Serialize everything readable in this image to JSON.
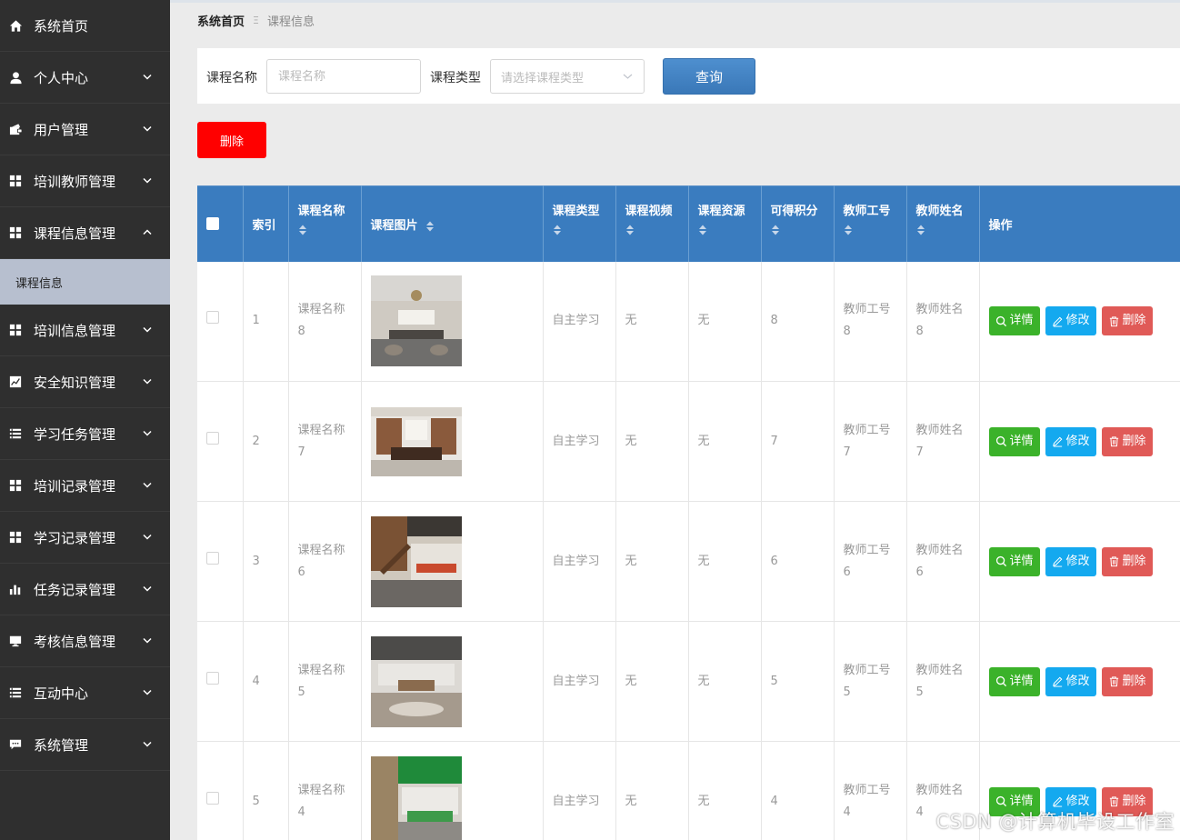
{
  "sidebar": {
    "items": [
      {
        "label": "系统首页",
        "icon": "home-icon",
        "expandable": false
      },
      {
        "label": "个人中心",
        "icon": "user-icon",
        "expandable": true
      },
      {
        "label": "用户管理",
        "icon": "user-manage-icon",
        "expandable": true
      },
      {
        "label": "培训教师管理",
        "icon": "grid-icon",
        "expandable": true
      },
      {
        "label": "课程信息管理",
        "icon": "grid-icon",
        "expandable": true,
        "expanded": true,
        "children": [
          "课程信息"
        ]
      },
      {
        "label": "培训信息管理",
        "icon": "grid-icon",
        "expandable": true
      },
      {
        "label": "安全知识管理",
        "icon": "chart-line-icon",
        "expandable": true
      },
      {
        "label": "学习任务管理",
        "icon": "list-icon",
        "expandable": true
      },
      {
        "label": "培训记录管理",
        "icon": "grid-icon",
        "expandable": true
      },
      {
        "label": "学习记录管理",
        "icon": "grid-icon",
        "expandable": true
      },
      {
        "label": "任务记录管理",
        "icon": "bar-chart-icon",
        "expandable": true
      },
      {
        "label": "考核信息管理",
        "icon": "monitor-icon",
        "expandable": true
      },
      {
        "label": "互动中心",
        "icon": "list-icon",
        "expandable": true
      },
      {
        "label": "系统管理",
        "icon": "chat-icon",
        "expandable": true
      }
    ]
  },
  "breadcrumb": {
    "home": "系统首页",
    "separator": "Ξ",
    "current": "课程信息"
  },
  "search": {
    "name_label": "课程名称",
    "name_placeholder": "课程名称",
    "type_label": "课程类型",
    "type_placeholder": "请选择课程类型",
    "query_label": "查询"
  },
  "toolbar": {
    "delete_label": "删除"
  },
  "table": {
    "headers": [
      "索引",
      "课程名称",
      "课程图片",
      "课程类型",
      "课程视频",
      "课程资源",
      "可得积分",
      "教师工号",
      "教师姓名",
      "操作"
    ],
    "actions": {
      "detail": "详情",
      "edit": "修改",
      "delete": "删除"
    },
    "rows": [
      {
        "index": "1",
        "name": [
          "课程名称",
          "8"
        ],
        "type": "自主学习",
        "video": "无",
        "resource": "无",
        "points": "8",
        "teacher_no": [
          "教师工号",
          "8"
        ],
        "teacher_name": [
          "教师姓名",
          "8"
        ]
      },
      {
        "index": "2",
        "name": [
          "课程名称",
          "7"
        ],
        "type": "自主学习",
        "video": "无",
        "resource": "无",
        "points": "7",
        "teacher_no": [
          "教师工号",
          "7"
        ],
        "teacher_name": [
          "教师姓名",
          "7"
        ]
      },
      {
        "index": "3",
        "name": [
          "课程名称",
          "6"
        ],
        "type": "自主学习",
        "video": "无",
        "resource": "无",
        "points": "6",
        "teacher_no": [
          "教师工号",
          "6"
        ],
        "teacher_name": [
          "教师姓名",
          "6"
        ]
      },
      {
        "index": "4",
        "name": [
          "课程名称",
          "5"
        ],
        "type": "自主学习",
        "video": "无",
        "resource": "无",
        "points": "5",
        "teacher_no": [
          "教师工号",
          "5"
        ],
        "teacher_name": [
          "教师姓名",
          "5"
        ]
      },
      {
        "index": "5",
        "name": [
          "课程名称",
          "4"
        ],
        "type": "自主学习",
        "video": "无",
        "resource": "无",
        "points": "4",
        "teacher_no": [
          "教师工号",
          "4"
        ],
        "teacher_name": [
          "教师姓名",
          "4"
        ]
      }
    ]
  },
  "watermark": "CSDN @计算机毕设工作室",
  "colors": {
    "sidebar_bg": "#2f2f2f",
    "submenu_bg": "#b7bfcf",
    "header_blue": "#3a7cbf",
    "delete_red": "#ff0000",
    "detail_green": "#3bb22a",
    "edit_blue": "#14a9ef",
    "remove_red": "#e05a57"
  }
}
